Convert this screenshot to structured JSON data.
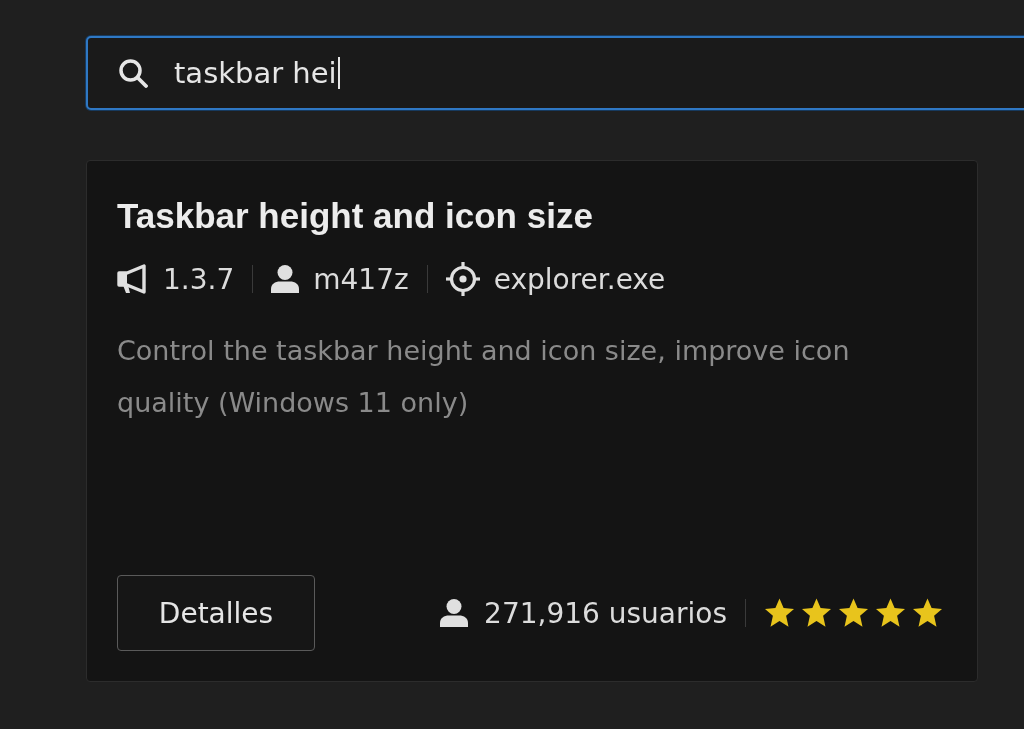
{
  "search": {
    "value": "taskbar hei",
    "focused": true
  },
  "mod_card": {
    "title": "Taskbar height and icon size",
    "meta": [
      {
        "kind": "version",
        "text": "1.3.7"
      },
      {
        "kind": "author",
        "text": "m417z"
      },
      {
        "kind": "process",
        "text": "explorer.exe"
      }
    ],
    "description": "Control the taskbar height and icon size, improve icon quality (Windows 11 only)",
    "details_button": "Detalles",
    "users": "271,916 usuarios",
    "stars": 5
  }
}
